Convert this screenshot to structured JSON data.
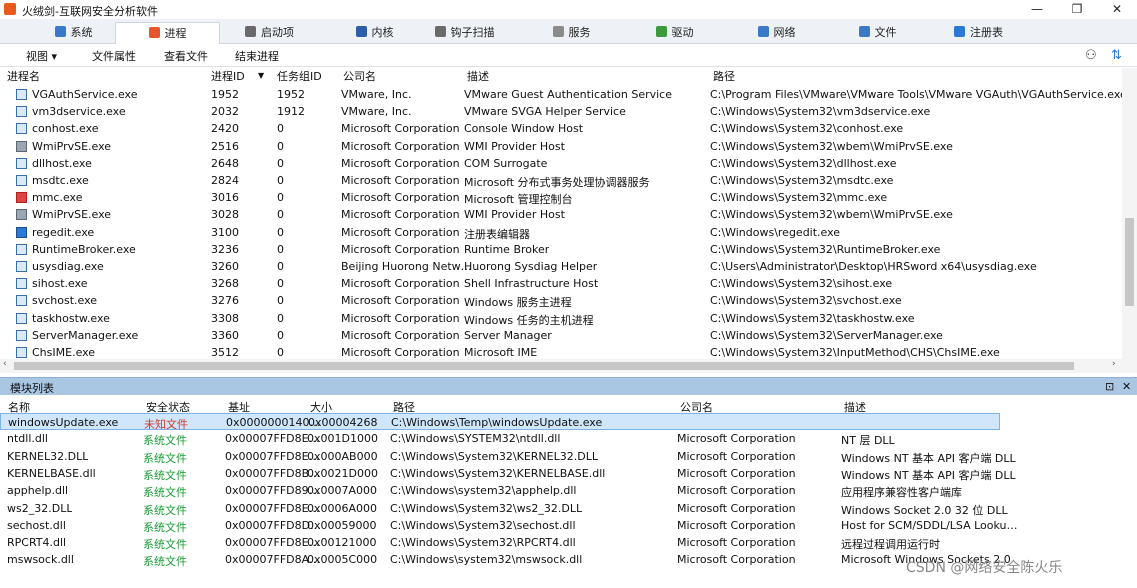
{
  "window": {
    "title": "火绒剑-互联网安全分析软件",
    "controls": [
      "—",
      "❐",
      "✕"
    ]
  },
  "tabs": [
    {
      "label": "系统",
      "icon": "monitor-icon",
      "color": "#3a78c8"
    },
    {
      "label": "进程",
      "icon": "windows-icon",
      "color": "#e8552a"
    },
    {
      "label": "启动项",
      "icon": "startup-icon",
      "color": "#6a6a6a"
    },
    {
      "label": "内核",
      "icon": "kernel-icon",
      "color": "#2f5ea8"
    },
    {
      "label": "钩子扫描",
      "icon": "hook-icon",
      "color": "#6a6a6a"
    },
    {
      "label": "服务",
      "icon": "service-icon",
      "color": "#8b8b8b"
    },
    {
      "label": "驱动",
      "icon": "driver-icon",
      "color": "#3c9a3c"
    },
    {
      "label": "网络",
      "icon": "network-icon",
      "color": "#3a78c8"
    },
    {
      "label": "文件",
      "icon": "file-icon",
      "color": "#3a78c8"
    },
    {
      "label": "注册表",
      "icon": "registry-icon",
      "color": "#2a7ad5"
    }
  ],
  "toolbar": {
    "view": "视图 ▾",
    "file_props": "文件属性",
    "view_file": "查看文件",
    "end_process": "结束进程"
  },
  "proc_columns": {
    "name": "进程名",
    "pid": "进程ID",
    "sort": "▼",
    "group": "任务组ID",
    "company": "公司名",
    "desc": "描述",
    "path": "路径"
  },
  "processes": [
    {
      "name": "VGAuthService.exe",
      "pid": "1952",
      "group": "1952",
      "company": "VMware, Inc.",
      "desc": "VMware Guest Authentication Service",
      "path": "C:\\Program Files\\VMware\\VMware Tools\\VMware VGAuth\\VGAuthService.exe",
      "icon": "app"
    },
    {
      "name": "vm3dservice.exe",
      "pid": "2032",
      "group": "1912",
      "company": "VMware, Inc.",
      "desc": "VMware SVGA Helper Service",
      "path": "C:\\Windows\\System32\\vm3dservice.exe",
      "icon": "app"
    },
    {
      "name": "conhost.exe",
      "pid": "2420",
      "group": "0",
      "company": "Microsoft Corporation",
      "desc": "Console Window Host",
      "path": "C:\\Windows\\System32\\conhost.exe",
      "icon": "app"
    },
    {
      "name": "WmiPrvSE.exe",
      "pid": "2516",
      "group": "0",
      "company": "Microsoft Corporation",
      "desc": "WMI Provider Host",
      "path": "C:\\Windows\\System32\\wbem\\WmiPrvSE.exe",
      "icon": "gear"
    },
    {
      "name": "dllhost.exe",
      "pid": "2648",
      "group": "0",
      "company": "Microsoft Corporation",
      "desc": "COM Surrogate",
      "path": "C:\\Windows\\System32\\dllhost.exe",
      "icon": "app"
    },
    {
      "name": "msdtc.exe",
      "pid": "2824",
      "group": "0",
      "company": "Microsoft Corporation",
      "desc": "Microsoft 分布式事务处理协调器服务",
      "path": "C:\\Windows\\System32\\msdtc.exe",
      "icon": "app"
    },
    {
      "name": "mmc.exe",
      "pid": "3016",
      "group": "0",
      "company": "Microsoft Corporation",
      "desc": "Microsoft 管理控制台",
      "path": "C:\\Windows\\System32\\mmc.exe",
      "icon": "red"
    },
    {
      "name": "WmiPrvSE.exe",
      "pid": "3028",
      "group": "0",
      "company": "Microsoft Corporation",
      "desc": "WMI Provider Host",
      "path": "C:\\Windows\\System32\\wbem\\WmiPrvSE.exe",
      "icon": "gear"
    },
    {
      "name": "regedit.exe",
      "pid": "3100",
      "group": "0",
      "company": "Microsoft Corporation",
      "desc": "注册表编辑器",
      "path": "C:\\Windows\\regedit.exe",
      "icon": "reg"
    },
    {
      "name": "RuntimeBroker.exe",
      "pid": "3236",
      "group": "0",
      "company": "Microsoft Corporation",
      "desc": "Runtime Broker",
      "path": "C:\\Windows\\System32\\RuntimeBroker.exe",
      "icon": "app"
    },
    {
      "name": "usysdiag.exe",
      "pid": "3260",
      "group": "0",
      "company": "Beijing Huorong Netw…",
      "desc": "Huorong Sysdiag Helper",
      "path": "C:\\Users\\Administrator\\Desktop\\HRSword x64\\usysdiag.exe",
      "icon": "app"
    },
    {
      "name": "sihost.exe",
      "pid": "3268",
      "group": "0",
      "company": "Microsoft Corporation",
      "desc": "Shell Infrastructure Host",
      "path": "C:\\Windows\\System32\\sihost.exe",
      "icon": "app"
    },
    {
      "name": "svchost.exe",
      "pid": "3276",
      "group": "0",
      "company": "Microsoft Corporation",
      "desc": "Windows 服务主进程",
      "path": "C:\\Windows\\System32\\svchost.exe",
      "icon": "app"
    },
    {
      "name": "taskhostw.exe",
      "pid": "3308",
      "group": "0",
      "company": "Microsoft Corporation",
      "desc": "Windows 任务的主机进程",
      "path": "C:\\Windows\\System32\\taskhostw.exe",
      "icon": "app"
    },
    {
      "name": "ServerManager.exe",
      "pid": "3360",
      "group": "0",
      "company": "Microsoft Corporation",
      "desc": "Server Manager",
      "path": "C:\\Windows\\System32\\ServerManager.exe",
      "icon": "app"
    },
    {
      "name": "ChsIME.exe",
      "pid": "3512",
      "group": "0",
      "company": "Microsoft Corporation",
      "desc": "Microsoft IME",
      "path": "C:\\Windows\\System32\\InputMethod\\CHS\\ChsIME.exe",
      "icon": "app"
    }
  ],
  "module_panel": {
    "title": "模块列表",
    "pin": "⊡",
    "close": "✕"
  },
  "mod_columns": {
    "name": "名称",
    "status": "安全状态",
    "base": "基址",
    "size": "大小",
    "path": "路径",
    "company": "公司名",
    "desc": "描述"
  },
  "modules": [
    {
      "name": "windowsUpdate.exe",
      "status": "未知文件",
      "base": "0x0000000140…",
      "size": "0x00004268",
      "path": "C:\\Windows\\Temp\\windowsUpdate.exe",
      "company": "",
      "desc": "",
      "selected": true,
      "status_type": "unknown"
    },
    {
      "name": "ntdll.dll",
      "status": "系统文件",
      "base": "0x00007FFD8E…",
      "size": "0x001D1000",
      "path": "C:\\Windows\\SYSTEM32\\ntdll.dll",
      "company": "Microsoft Corporation",
      "desc": "NT 层 DLL",
      "status_type": "system"
    },
    {
      "name": "KERNEL32.DLL",
      "status": "系统文件",
      "base": "0x00007FFD8E…",
      "size": "0x000AB000",
      "path": "C:\\Windows\\System32\\KERNEL32.DLL",
      "company": "Microsoft Corporation",
      "desc": "Windows NT 基本 API 客户端 DLL",
      "status_type": "system"
    },
    {
      "name": "KERNELBASE.dll",
      "status": "系统文件",
      "base": "0x00007FFD8B…",
      "size": "0x0021D000",
      "path": "C:\\Windows\\System32\\KERNELBASE.dll",
      "company": "Microsoft Corporation",
      "desc": "Windows NT 基本 API 客户端 DLL",
      "status_type": "system"
    },
    {
      "name": "apphelp.dll",
      "status": "系统文件",
      "base": "0x00007FFD89…",
      "size": "0x0007A000",
      "path": "C:\\Windows\\system32\\apphelp.dll",
      "company": "Microsoft Corporation",
      "desc": "应用程序兼容性客户端库",
      "status_type": "system"
    },
    {
      "name": "ws2_32.DLL",
      "status": "系统文件",
      "base": "0x00007FFD8E…",
      "size": "0x0006A000",
      "path": "C:\\Windows\\System32\\ws2_32.DLL",
      "company": "Microsoft Corporation",
      "desc": "Windows Socket 2.0 32 位 DLL",
      "status_type": "system"
    },
    {
      "name": "sechost.dll",
      "status": "系统文件",
      "base": "0x00007FFD8D…",
      "size": "0x00059000",
      "path": "C:\\Windows\\System32\\sechost.dll",
      "company": "Microsoft Corporation",
      "desc": "Host for SCM/SDDL/LSA Looku…",
      "status_type": "system"
    },
    {
      "name": "RPCRT4.dll",
      "status": "系统文件",
      "base": "0x00007FFD8E…",
      "size": "0x00121000",
      "path": "C:\\Windows\\System32\\RPCRT4.dll",
      "company": "Microsoft Corporation",
      "desc": "远程过程调用运行时",
      "status_type": "system"
    },
    {
      "name": "mswsock.dll",
      "status": "系统文件",
      "base": "0x00007FFD8A…",
      "size": "0x0005C000",
      "path": "C:\\Windows\\system32\\mswsock.dll",
      "company": "Microsoft Corporation",
      "desc": "Microsoft Windows Sockets 2.0",
      "status_type": "system"
    }
  ],
  "watermark": "CSDN @网络安全陈火乐"
}
